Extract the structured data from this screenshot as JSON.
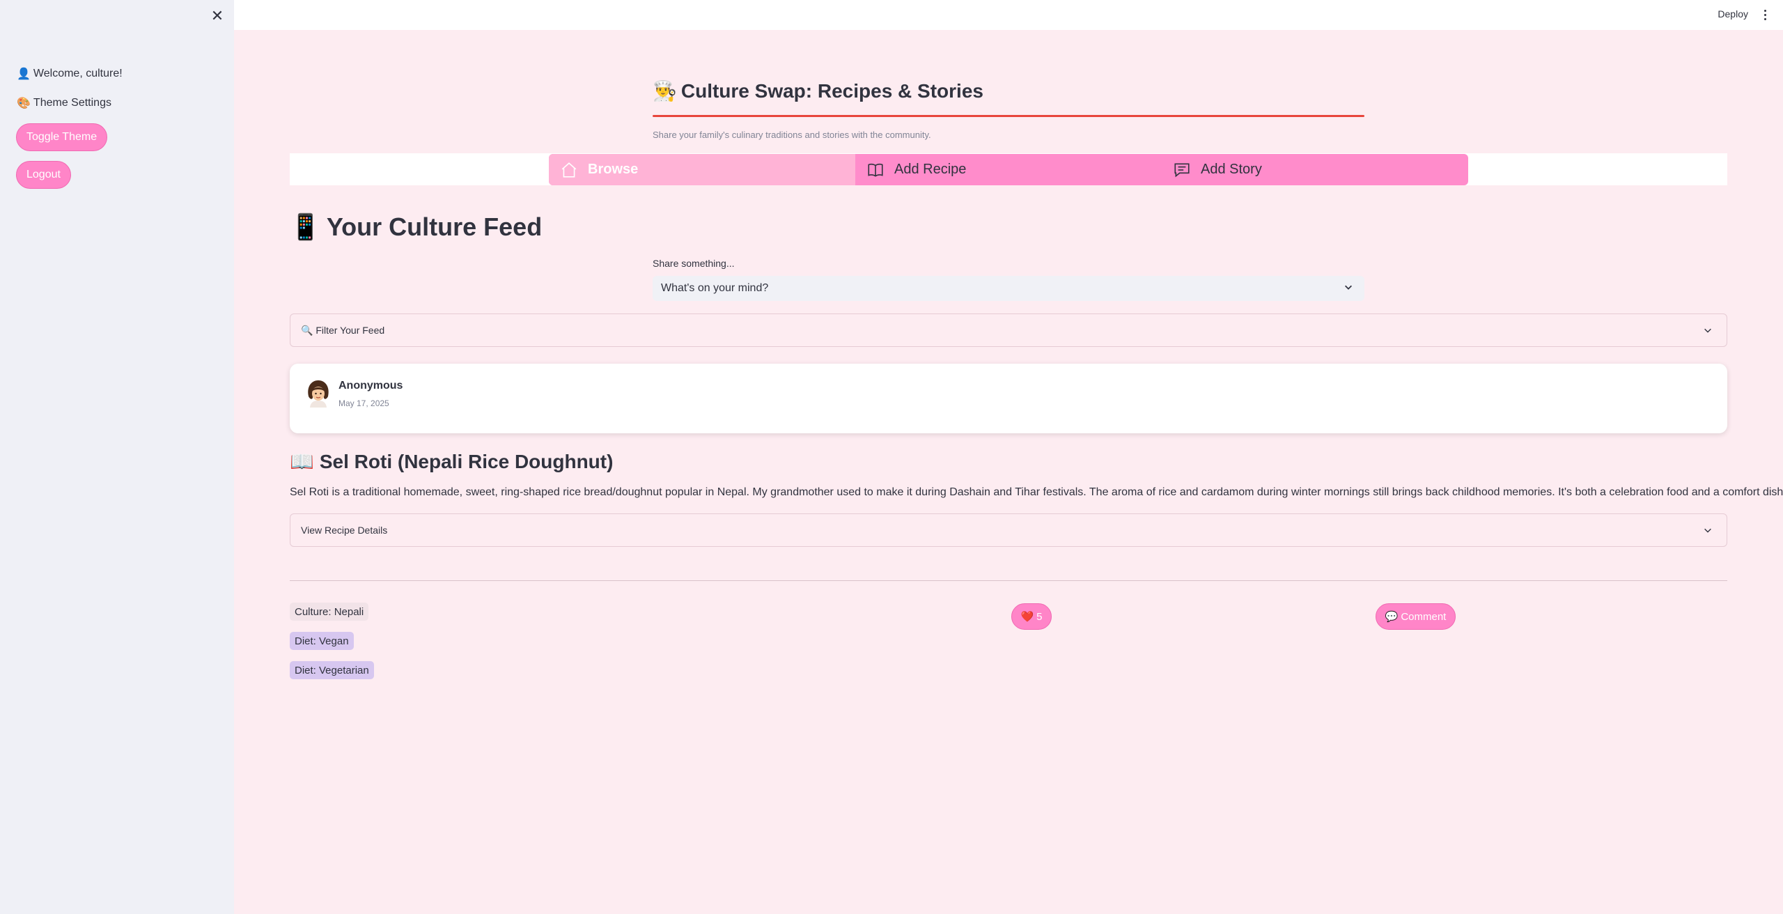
{
  "sidebar": {
    "welcome": "Welcome, culture!",
    "welcome_icon": "👤",
    "theme_settings": "Theme Settings",
    "theme_icon": "🎨",
    "toggle_theme_label": "Toggle Theme",
    "logout_label": "Logout"
  },
  "topbar": {
    "deploy_label": "Deploy"
  },
  "header": {
    "icon": "👨‍🍳",
    "title": "Culture Swap: Recipes & Stories",
    "subtitle": "Share your family's culinary traditions and stories with the community."
  },
  "nav": {
    "tabs": [
      {
        "label": "Browse",
        "icon": "home-icon"
      },
      {
        "label": "Add Recipe",
        "icon": "book-icon"
      },
      {
        "label": "Add Story",
        "icon": "message-icon"
      }
    ],
    "active_index": 0
  },
  "feed": {
    "icon": "📱",
    "title": "Your Culture Feed",
    "share_label": "Share something...",
    "share_select_value": "What's on your mind?",
    "filter_label": "🔍 Filter Your Feed"
  },
  "post": {
    "author": "Anonymous",
    "date": "May 17, 2025",
    "title_icon": "📖",
    "title": "Sel Roti (Nepali Rice Doughnut)",
    "description": "Sel Roti is a traditional homemade, sweet, ring-shaped rice bread/doughnut popular in Nepal. My grandmother used to make it during Dashain and Tihar festivals. The aroma of rice and cardamom during winter mornings still brings back childhood memories. It's both a celebration food and a comfort dish.",
    "details_label": "View Recipe Details",
    "tags": {
      "culture": "Culture: Nepali",
      "diet_1": "Diet: Vegan",
      "diet_2": "Diet: Vegetarian"
    },
    "like_icon": "❤️",
    "like_count": "5",
    "comment_icon": "💬",
    "comment_label": "Comment"
  },
  "colors": {
    "accent": "#ff85c8",
    "background": "#fdecf1",
    "sidebar": "#eff0f6",
    "title_rule": "#e8453c"
  }
}
